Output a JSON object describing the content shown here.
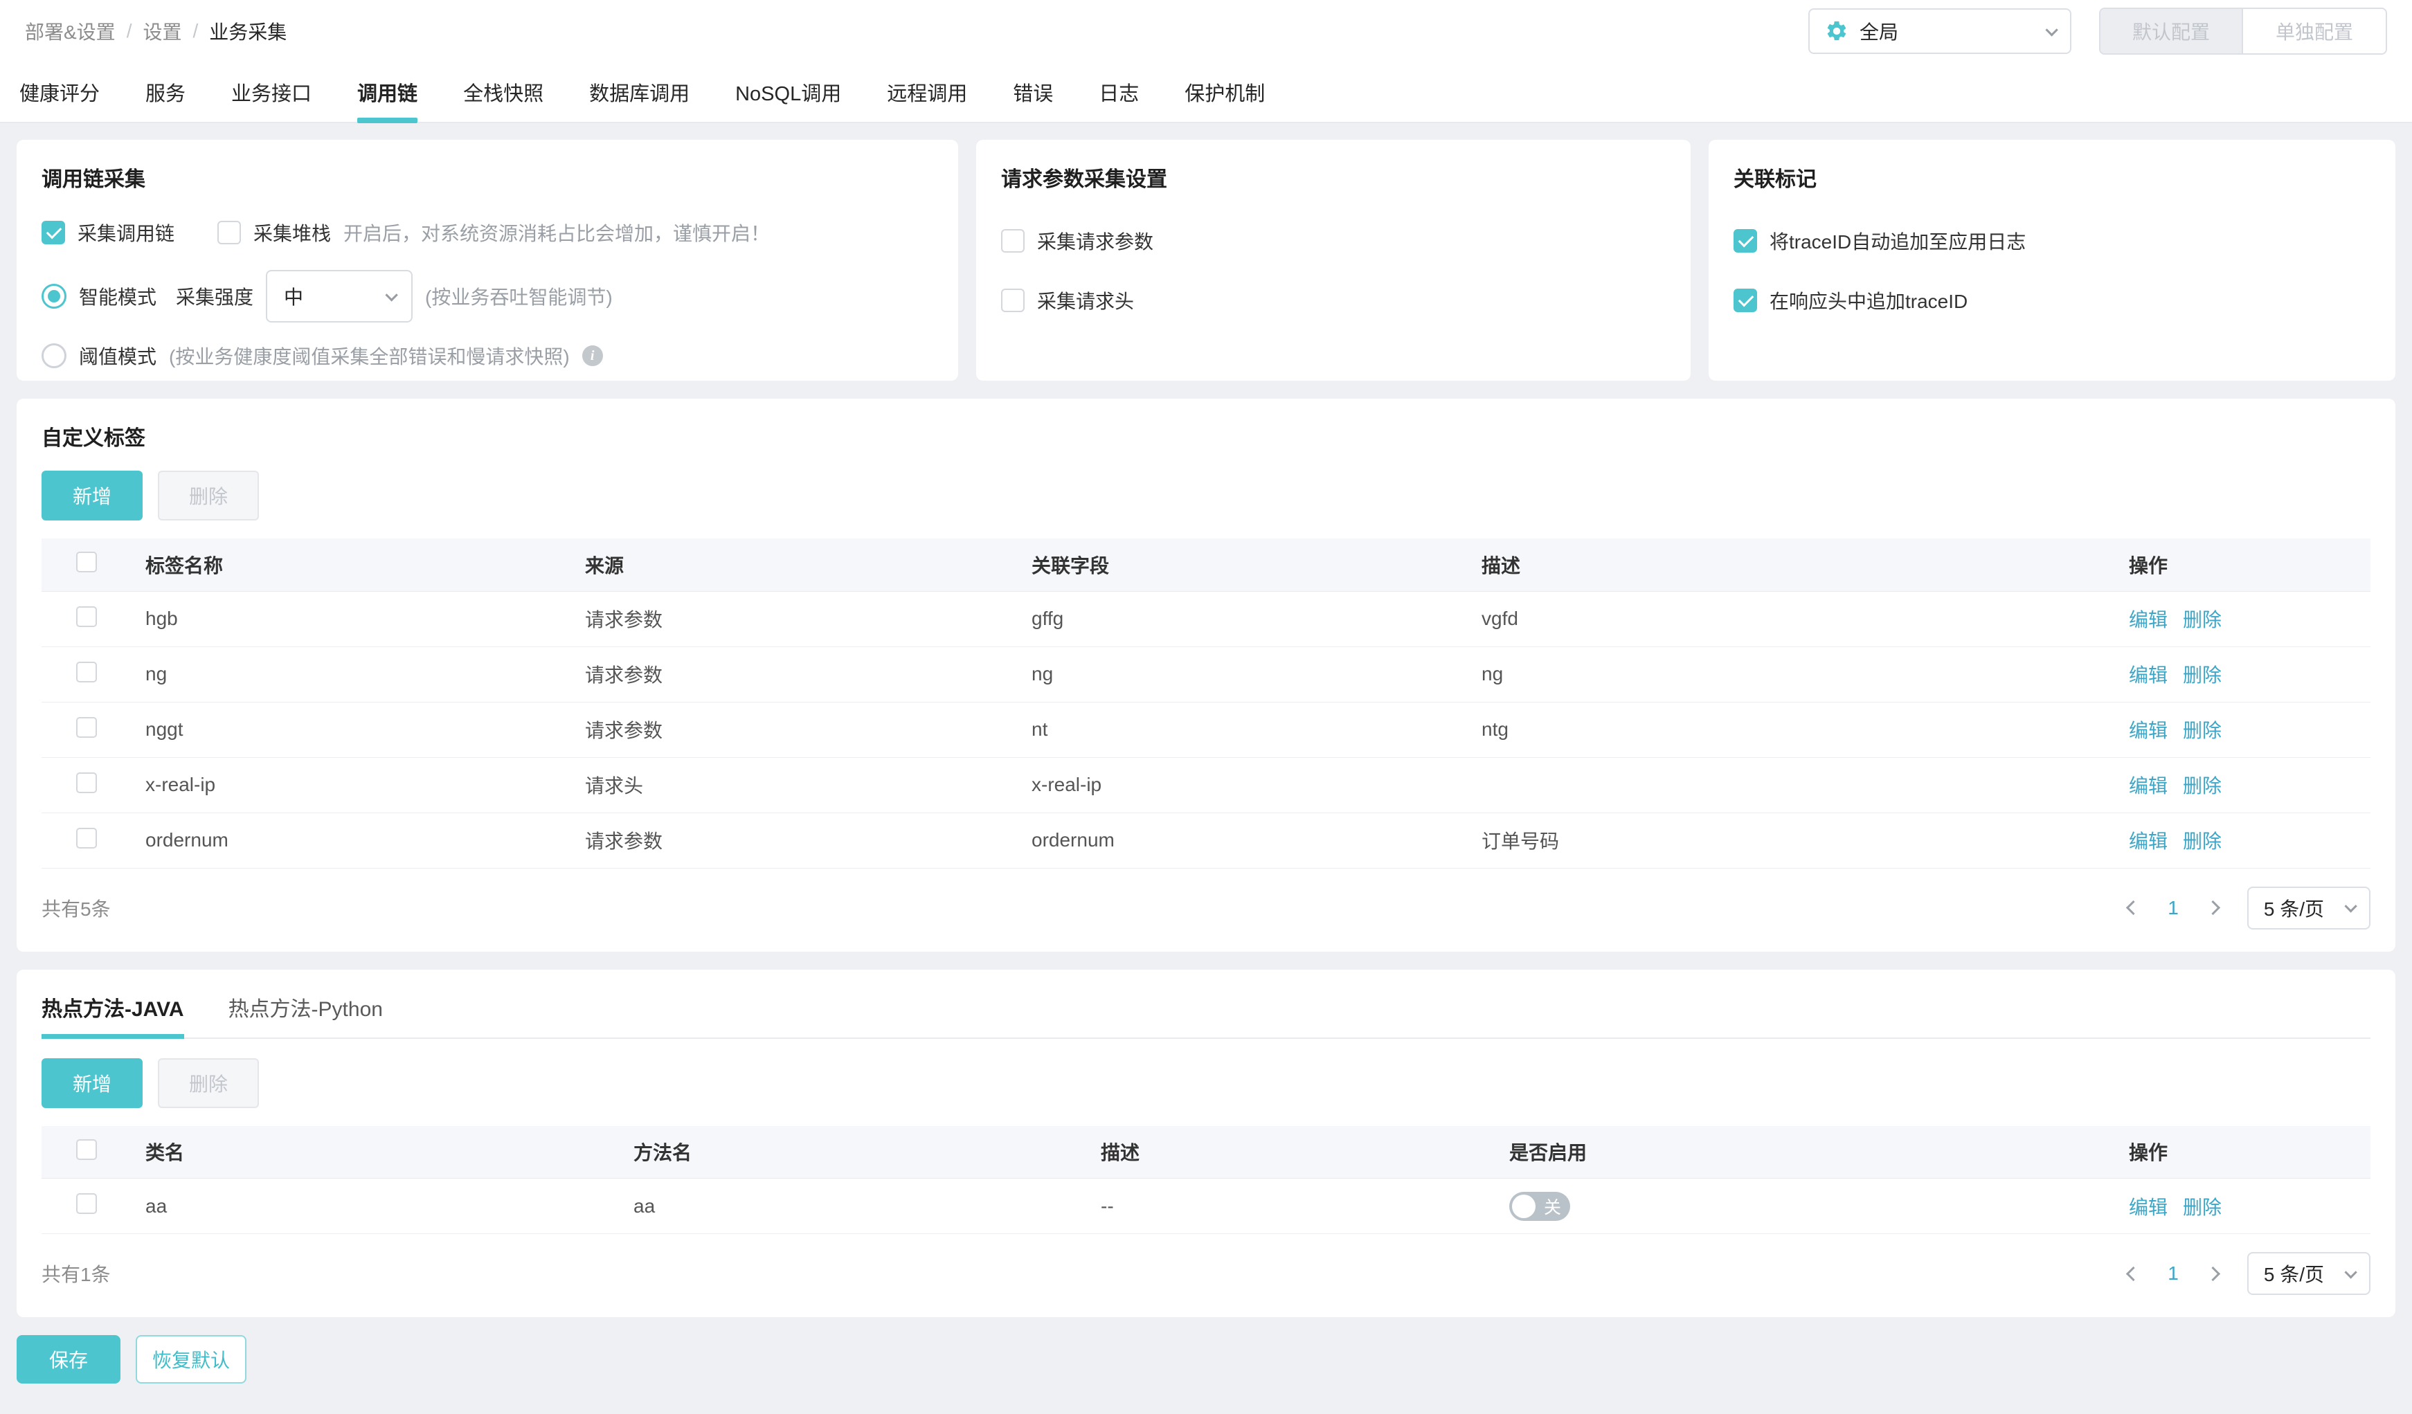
{
  "colors": {
    "accent": "#4cc5cf",
    "link": "#3aa6c8",
    "toggle_off": "#b9c2c9"
  },
  "breadcrumb": {
    "items": [
      "部署&设置",
      "设置",
      "业务采集"
    ]
  },
  "topbar": {
    "scope_select": {
      "icon": "gear-icon",
      "value": "全局"
    },
    "default_config_label": "默认配置",
    "separate_config_label": "单独配置"
  },
  "nav_tabs": {
    "active": "调用链",
    "items": [
      "健康评分",
      "服务",
      "业务接口",
      "调用链",
      "全栈快照",
      "数据库调用",
      "NoSQL调用",
      "远程调用",
      "错误",
      "日志",
      "保护机制"
    ]
  },
  "trace_panel": {
    "title": "调用链采集",
    "collect_trace": {
      "label": "采集调用链",
      "checked": true
    },
    "collect_stack": {
      "label": "采集堆栈",
      "checked": false,
      "hint": "开启后，对系统资源消耗占比会增加，谨慎开启！"
    },
    "smart_mode": {
      "label": "智能模式",
      "selected": true,
      "strength_label": "采集强度",
      "strength_value": "中",
      "hint": "(按业务吞吐智能调节)"
    },
    "threshold_mode": {
      "label": "阈值模式",
      "selected": false,
      "hint": "(按业务健康度阈值采集全部错误和慢请求快照)"
    }
  },
  "request_panel": {
    "title": "请求参数采集设置",
    "collect_params": {
      "label": "采集请求参数",
      "checked": false
    },
    "collect_headers": {
      "label": "采集请求头",
      "checked": false
    }
  },
  "marker_panel": {
    "title": "关联标记",
    "trace_to_log": {
      "label": "将traceID自动追加至应用日志",
      "checked": true
    },
    "trace_to_header": {
      "label": "在响应头中追加traceID",
      "checked": true
    }
  },
  "custom_tags": {
    "title": "自定义标签",
    "add_label": "新增",
    "delete_label": "删除",
    "edit_label": "编辑",
    "remove_label": "删除",
    "columns": [
      "标签名称",
      "来源",
      "关联字段",
      "描述",
      "操作"
    ],
    "rows": [
      {
        "name": "hgb",
        "source": "请求参数",
        "field": "gffg",
        "desc": "vgfd"
      },
      {
        "name": "ng",
        "source": "请求参数",
        "field": "ng",
        "desc": "ng"
      },
      {
        "name": "nggt",
        "source": "请求参数",
        "field": "nt",
        "desc": "ntg"
      },
      {
        "name": "x-real-ip",
        "source": "请求头",
        "field": "x-real-ip",
        "desc": ""
      },
      {
        "name": "ordernum",
        "source": "请求参数",
        "field": "ordernum",
        "desc": "订单号码"
      }
    ],
    "total_text": "共有5条",
    "pagination": {
      "current": "1",
      "page_size": "5 条/页"
    }
  },
  "hot_methods": {
    "tabs": [
      "热点方法-JAVA",
      "热点方法-Python"
    ],
    "active_tab": "热点方法-JAVA",
    "add_label": "新增",
    "delete_label": "删除",
    "edit_label": "编辑",
    "remove_label": "删除",
    "columns": [
      "类名",
      "方法名",
      "描述",
      "是否启用",
      "操作"
    ],
    "rows": [
      {
        "class_name": "aa",
        "method_name": "aa",
        "desc": "--",
        "enabled": false,
        "toggle_state_label": "关"
      }
    ],
    "total_text": "共有1条",
    "pagination": {
      "current": "1",
      "page_size": "5 条/页"
    }
  },
  "footer": {
    "save_label": "保存",
    "reset_label": "恢复默认"
  }
}
